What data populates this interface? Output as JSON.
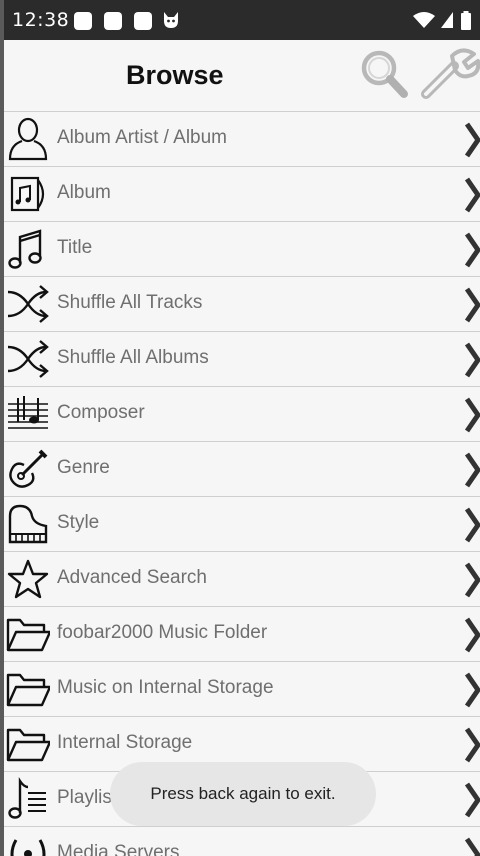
{
  "status": {
    "time": "12:38"
  },
  "header": {
    "title": "Browse",
    "search_icon": "search-icon",
    "settings_icon": "wrench-icon"
  },
  "items": [
    {
      "label": "Album Artist / Album",
      "icon": "person-icon"
    },
    {
      "label": "Album",
      "icon": "album-icon"
    },
    {
      "label": "Title",
      "icon": "music-note-icon"
    },
    {
      "label": "Shuffle All Tracks",
      "icon": "shuffle-icon"
    },
    {
      "label": "Shuffle All Albums",
      "icon": "shuffle-icon"
    },
    {
      "label": "Composer",
      "icon": "staff-icon"
    },
    {
      "label": "Genre",
      "icon": "guitar-icon"
    },
    {
      "label": "Style",
      "icon": "piano-icon"
    },
    {
      "label": "Advanced Search",
      "icon": "star-icon"
    },
    {
      "label": "foobar2000 Music Folder",
      "icon": "folder-icon"
    },
    {
      "label": "Music on Internal Storage",
      "icon": "folder-icon"
    },
    {
      "label": "Internal Storage",
      "icon": "folder-icon"
    },
    {
      "label": "Playlists",
      "icon": "playlist-icon"
    },
    {
      "label": "Media Servers",
      "icon": "broadcast-icon"
    }
  ],
  "toast": {
    "message": "Press back again to exit."
  }
}
